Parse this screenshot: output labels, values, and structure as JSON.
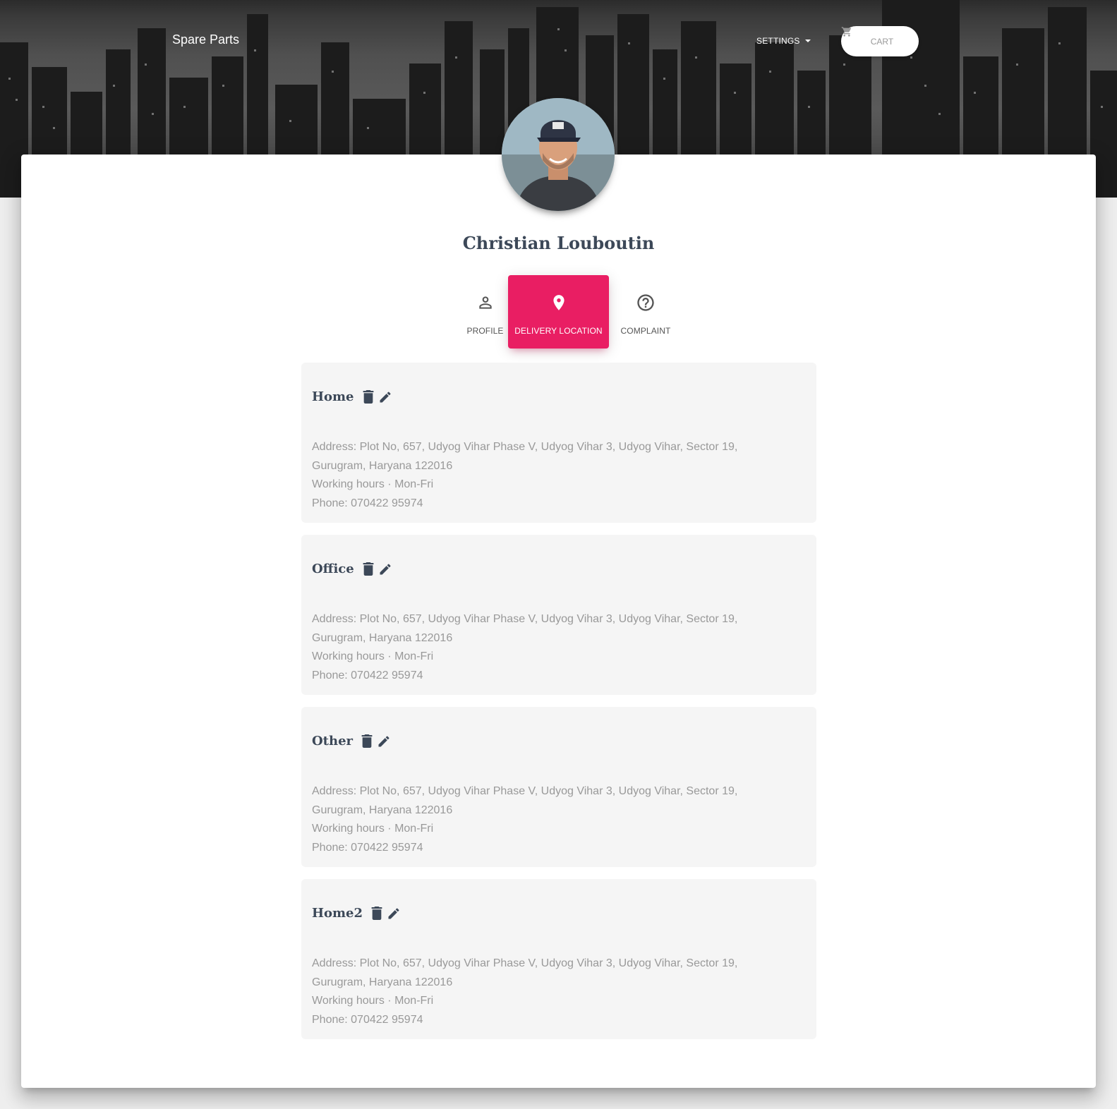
{
  "nav": {
    "brand": "Spare Parts",
    "settings_label": "SETTINGS",
    "cart_label": "CART"
  },
  "profile": {
    "name": "Christian Louboutin"
  },
  "tabs": [
    {
      "label": "PROFILE",
      "icon": "person-icon",
      "active": false
    },
    {
      "label": "DELIVERY LOCATION",
      "icon": "location-pin-icon",
      "active": true
    },
    {
      "label": "COMPLAINT",
      "icon": "help-circle-icon",
      "active": false
    }
  ],
  "addresses": [
    {
      "title": "Home",
      "address": "Address: Plot No, 657, Udyog Vihar Phase V, Udyog Vihar 3, Udyog Vihar, Sector 19, Gurugram, Haryana 122016",
      "hours": "Working hours · Mon-Fri",
      "phone": "Phone: 070422 95974"
    },
    {
      "title": "Office",
      "address": "Address: Plot No, 657, Udyog Vihar Phase V, Udyog Vihar 3, Udyog Vihar, Sector 19, Gurugram, Haryana 122016",
      "hours": "Working hours · Mon-Fri",
      "phone": "Phone: 070422 95974"
    },
    {
      "title": "Other",
      "address": "Address: Plot No, 657, Udyog Vihar Phase V, Udyog Vihar 3, Udyog Vihar, Sector 19, Gurugram, Haryana 122016",
      "hours": "Working hours · Mon-Fri",
      "phone": "Phone: 070422 95974"
    },
    {
      "title": "Home2",
      "address": "Address: Plot No, 657, Udyog Vihar Phase V, Udyog Vihar 3, Udyog Vihar, Sector 19, Gurugram, Haryana 122016",
      "hours": "Working hours · Mon-Fri",
      "phone": "Phone: 070422 95974"
    }
  ],
  "colors": {
    "accent": "#e91e63",
    "heading": "#3c4858",
    "muted_text": "#999999",
    "box_bg": "#f5f5f5"
  }
}
